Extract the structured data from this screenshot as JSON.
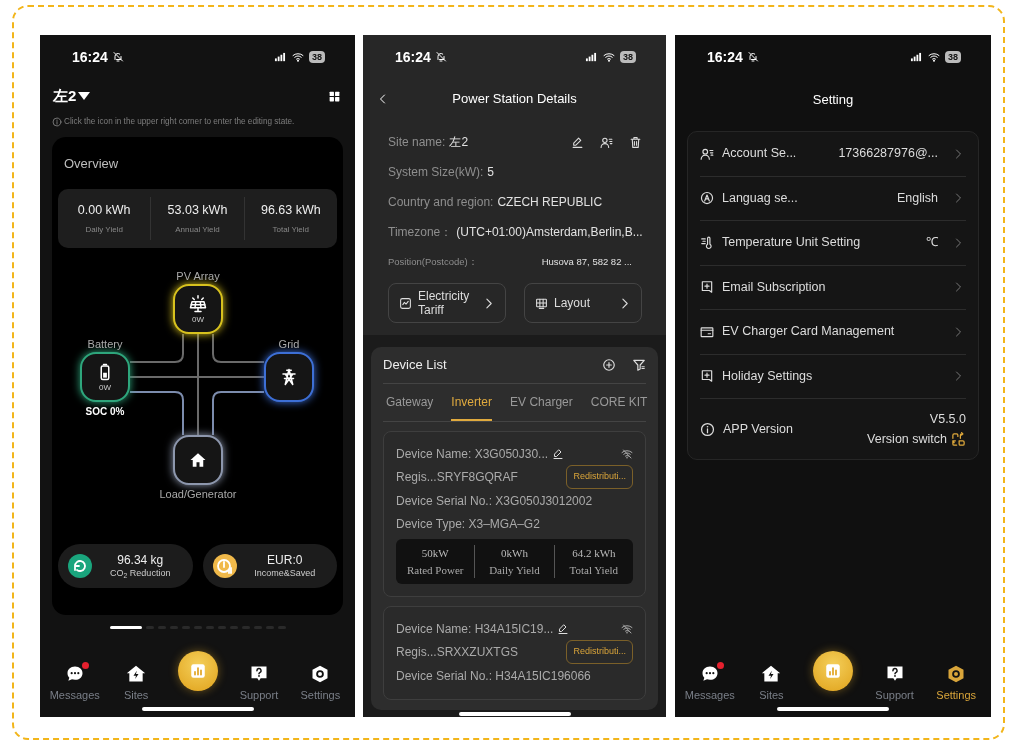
{
  "home_screen": {
    "status_bar": {
      "time": "16:24",
      "battery": "38"
    },
    "site": "左2",
    "hint": "Click the icon in the upper right corner to enter the editing state.",
    "overview": {
      "title": "Overview",
      "stats": [
        {
          "value": "0.00 kWh",
          "label": "Daily Yield"
        },
        {
          "value": "53.03 kWh",
          "label": "Annual Yield"
        },
        {
          "value": "96.63 kWh",
          "label": "Total Yield"
        }
      ]
    },
    "flow": {
      "nodes": [
        {
          "kind": "pv",
          "label": "PV Array",
          "value": "0W",
          "color": "#d8c21e"
        },
        {
          "kind": "battery",
          "label": "Battery",
          "value": "0W",
          "color": "#2ea67c"
        },
        {
          "kind": "grid",
          "label": "Grid",
          "color": "#3d6fd6"
        },
        {
          "kind": "load",
          "label": "Load/Generator",
          "color": "#8d97ad"
        }
      ],
      "soc": "SOC 0%"
    },
    "summary": [
      {
        "kind": "co2",
        "value": "96.34 kg",
        "label": "CO$_{2}$ Reduction"
      },
      {
        "kind": "income",
        "value": "EUR:0",
        "label": "Income&Saved"
      }
    ],
    "pager": [
      {
        "selected": true
      },
      {
        "selected": false
      },
      {
        "selected": false
      },
      {
        "selected": false
      },
      {
        "selected": false
      },
      {
        "selected": false
      },
      {
        "selected": false
      },
      {
        "selected": false
      },
      {
        "selected": false
      },
      {
        "selected": false
      },
      {
        "selected": false
      },
      {
        "selected": false
      },
      {
        "selected": false
      }
    ],
    "tab_bar": [
      {
        "kind": "messages",
        "label": "Messages",
        "badge": true,
        "selected": false
      },
      {
        "kind": "sites",
        "label": "Sites",
        "badge": false,
        "selected": false
      },
      {
        "kind": "center"
      },
      {
        "kind": "support",
        "label": "Support",
        "badge": false,
        "selected": false
      },
      {
        "kind": "settings",
        "label": "Settings",
        "badge": false,
        "selected": false
      }
    ]
  },
  "details_screen": {
    "status_bar": {
      "time": "16:24",
      "battery": "38"
    },
    "title": "Power Station Details",
    "info": [
      {
        "kind": "site",
        "label": "Site name:",
        "value": "左2"
      },
      {
        "kind": "plain",
        "label": "System Size(kW):",
        "value": "5"
      },
      {
        "kind": "plain",
        "label": "Country and region:",
        "value": "CZECH REPUBLIC"
      },
      {
        "kind": "plain",
        "label": "Timezone：",
        "value": "(UTC+01:00)Amsterdam,Berlin,B..."
      },
      {
        "kind": "small",
        "label": "Position(Postcode)：",
        "value": "Husova 87, 582 82 ..."
      }
    ],
    "links": [
      {
        "kind": "tariff",
        "label": "Electricity Tariff"
      },
      {
        "kind": "layout",
        "label": "Layout"
      }
    ],
    "device_list": {
      "title": "Device List",
      "tabs": [
        {
          "label": "Gateway",
          "selected": false
        },
        {
          "label": "Inverter",
          "selected": true
        },
        {
          "label": "EV Charger",
          "selected": false
        },
        {
          "label": "CORE KIT",
          "selected": false
        }
      ],
      "devices": [
        {
          "name": "Device Name: X3G050J30...",
          "registration": "Regis...SRYF8GQRAF",
          "tag": "Redistributi...",
          "serial": "Device Serial No.: X3G050J3012002",
          "type": "Device Type: X3–MGA–G2",
          "stats": [
            {
              "value": "50kW",
              "label": "Rated Power"
            },
            {
              "value": "0kWh",
              "label": "Daily Yield"
            },
            {
              "value": "64.2 kWh",
              "label": "Total Yield"
            }
          ]
        },
        {
          "name": "Device Name: H34A15IC19...",
          "registration": "Regis...SRXXZUXTGS",
          "tag": "Redistributi...",
          "serial": "Device Serial No.: H34A15IC196066"
        }
      ]
    }
  },
  "settings_screen": {
    "status_bar": {
      "time": "16:24",
      "battery": "38"
    },
    "title": "Setting",
    "items": [
      {
        "kind": "account",
        "label": "Account Se...",
        "value": "17366287976@..."
      },
      {
        "kind": "language",
        "label": "Languag se...",
        "value": "English"
      },
      {
        "kind": "temperature",
        "label": "Temperature Unit Setting",
        "value": "℃"
      },
      {
        "kind": "email",
        "label": "Email Subscription"
      },
      {
        "kind": "card",
        "label": "EV Charger Card Management"
      },
      {
        "kind": "holiday",
        "label": "Holiday Settings"
      }
    ],
    "version": {
      "label": "APP Version",
      "value": "V5.5.0",
      "switch": "Version switch"
    },
    "tab_bar": [
      {
        "kind": "messages",
        "label": "Messages",
        "badge": true,
        "selected": false
      },
      {
        "kind": "sites",
        "label": "Sites",
        "badge": false,
        "selected": false
      },
      {
        "kind": "center"
      },
      {
        "kind": "support",
        "label": "Support",
        "badge": false,
        "selected": false
      },
      {
        "kind": "settings",
        "label": "Settings",
        "badge": false,
        "selected": true
      }
    ]
  }
}
